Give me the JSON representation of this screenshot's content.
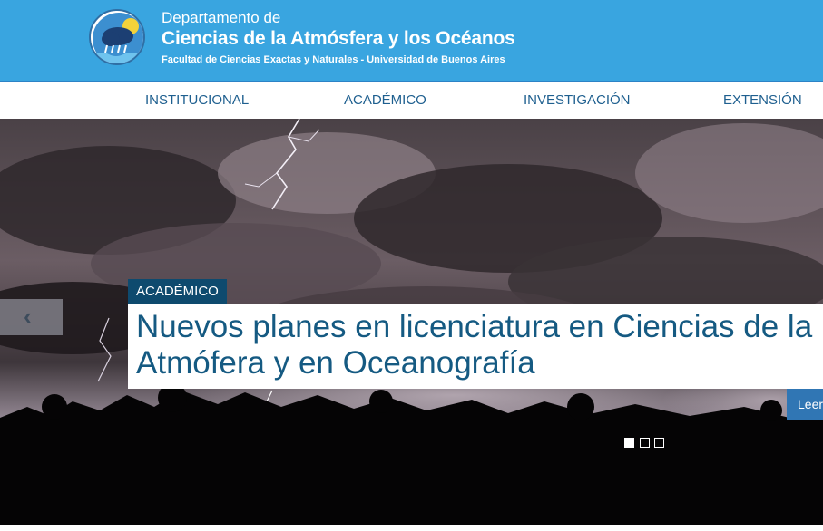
{
  "header": {
    "title_line1": "Departamento de",
    "title_line2": "Ciencias de la Atmósfera y los Océanos",
    "subtitle": "Facultad de Ciencias Exactas y Naturales - Universidad de Buenos Aires",
    "background_color": "#39a5e0"
  },
  "nav": {
    "items": [
      {
        "label": "INSTITUCIONAL"
      },
      {
        "label": "ACADÉMICO"
      },
      {
        "label": "INVESTIGACIÓN"
      },
      {
        "label": "EXTENSIÓN"
      }
    ]
  },
  "slider": {
    "category": "ACADÉMICO",
    "headline_line1": "Nuevos planes en licenciatura en Ciencias de la",
    "headline_line2": "Atmófera y en Oceanografía",
    "read_more": "Leer más",
    "prev_icon": "chevron-left-icon",
    "dots_total": 3,
    "active_dot": 1,
    "accent_color": "#0e4a6e",
    "button_color": "#3076b4"
  }
}
